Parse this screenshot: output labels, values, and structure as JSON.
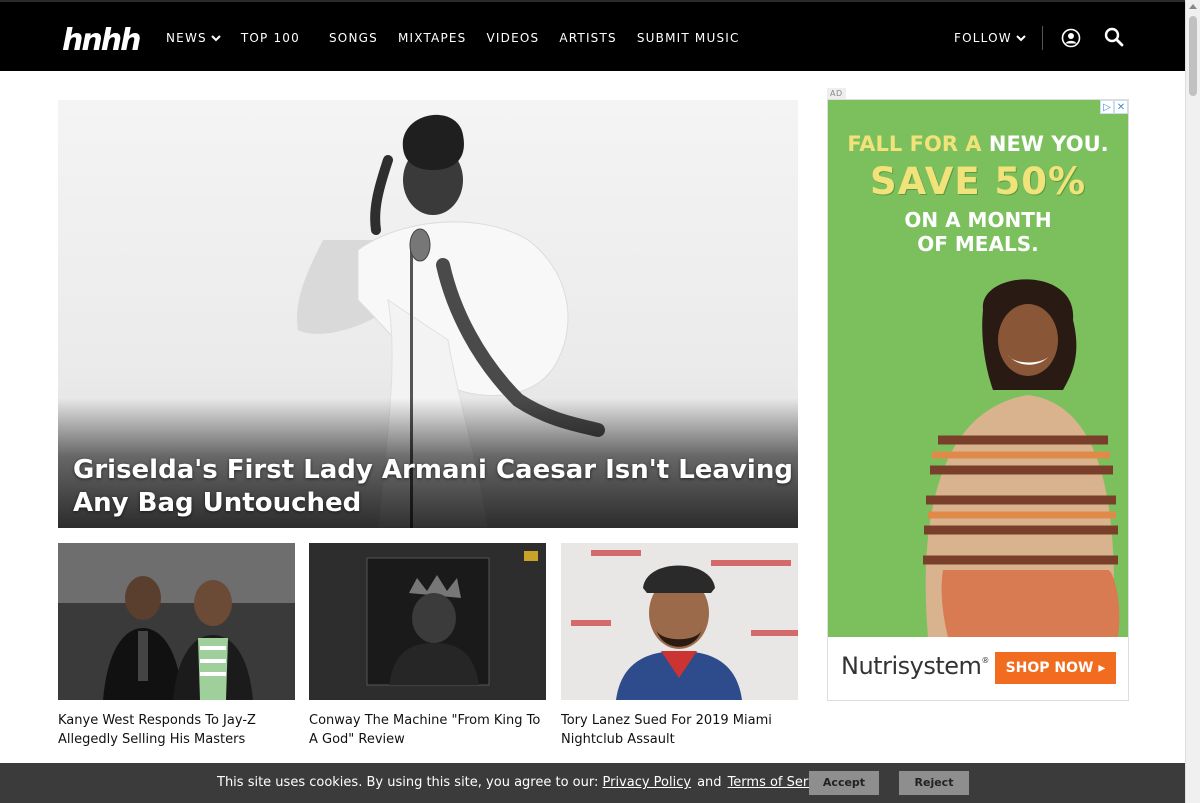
{
  "header": {
    "logo": "hnhh",
    "nav": [
      "NEWS",
      "TOP 100",
      "SONGS",
      "MIXTAPES",
      "VIDEOS",
      "ARTISTS",
      "SUBMIT MUSIC"
    ],
    "follow": "FOLLOW"
  },
  "hero": {
    "title": "Griselda's First Lady Armani Caesar Isn't Leaving Any Bag Untouched"
  },
  "cards": [
    {
      "caption": "Kanye West Responds To Jay-Z Allegedly Selling His Masters"
    },
    {
      "caption": "Conway The Machine \"From King To A God\" Review"
    },
    {
      "caption": "Tory Lanez Sued For 2019 Miami Nightclub Assault"
    }
  ],
  "ad": {
    "label": "AD",
    "line1_a": "FALL FOR A ",
    "line1_b": "NEW YOU.",
    "line2": "SAVE 50%",
    "line3a": "ON A MONTH",
    "line3b": "OF MEALS.",
    "brand": "Nutrisystem",
    "brand_mark": "®",
    "cta": "SHOP NOW ▸"
  },
  "cookie": {
    "text": "This site uses cookies. By using this site, you agree to our:",
    "privacy": "Privacy Policy",
    "and": "and",
    "terms": "Terms of Service",
    "period": ".",
    "accept": "Accept",
    "reject": "Reject"
  },
  "colors": {
    "header_bg": "#000000",
    "ad_green": "#7cc05e",
    "ad_yellow": "#f2e27a",
    "ad_cta": "#f26c1f",
    "cookie_bg": "#3b3b3b"
  }
}
